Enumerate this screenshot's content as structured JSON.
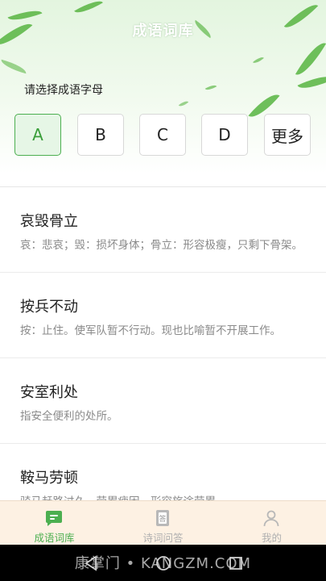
{
  "header": {
    "title": "成语词库",
    "choose_label": "请选择成语字母"
  },
  "letter_tabs": [
    {
      "label": "A",
      "active": true
    },
    {
      "label": "B",
      "active": false
    },
    {
      "label": "C",
      "active": false
    },
    {
      "label": "D",
      "active": false
    },
    {
      "label": "更多",
      "active": false
    }
  ],
  "idioms": [
    {
      "title": "哀毁骨立",
      "desc": "哀：悲哀；毁：损坏身体；骨立：形容极瘦，只剩下骨架。"
    },
    {
      "title": "按兵不动",
      "desc": "按：止住。使军队暂不行动。现也比喻暂不开展工作。"
    },
    {
      "title": "安室利处",
      "desc": "指安全便利的处所。"
    },
    {
      "title": "鞍马劳顿",
      "desc": "骑马赶路过久，劳累疲困。形容旅途劳累。"
    }
  ],
  "bottom_nav": [
    {
      "label": "成语词库",
      "icon": "chat-bubble-icon",
      "active": true
    },
    {
      "label": "诗词问答",
      "icon": "answer-book-icon",
      "active": false
    },
    {
      "label": "我的",
      "icon": "user-profile-icon",
      "active": false
    }
  ],
  "watermark": "康掌门 • KANGZM.COM",
  "colors": {
    "accent": "#4caf50",
    "active_tab_bg": "#e6f6e6",
    "nav_bg": "#fdf1e3"
  }
}
